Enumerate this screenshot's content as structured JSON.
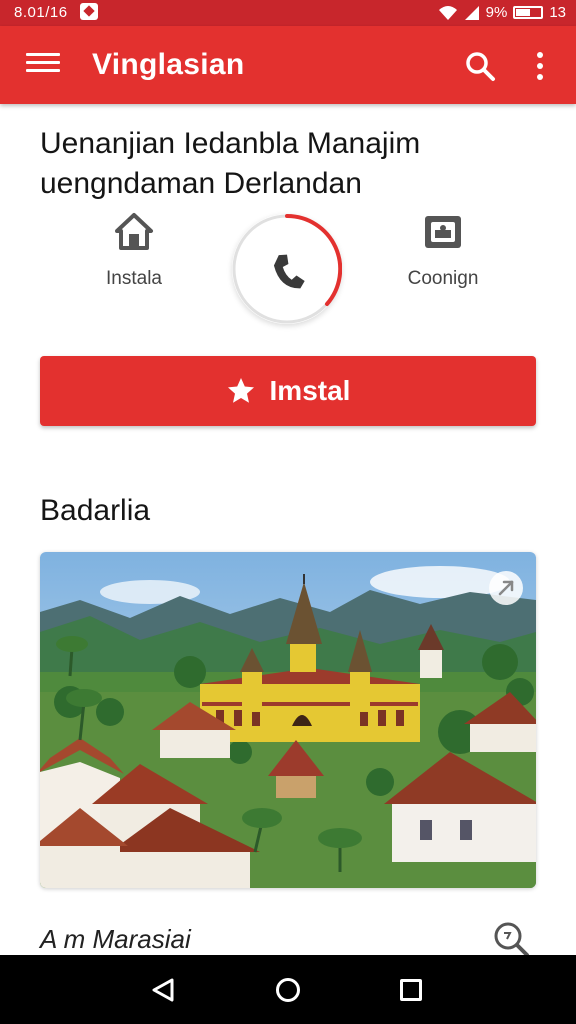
{
  "status_bar": {
    "time": "8.01/16",
    "battery": "9%",
    "extra": "13"
  },
  "app_bar": {
    "title": "Vinglasian"
  },
  "headline": {
    "line1": "Uenanjian Iedanbla Manajim",
    "line2": "uengndaman Derlandan"
  },
  "quick_actions": [
    {
      "label": "Instala",
      "icon": "home-icon"
    },
    {
      "label": "",
      "icon": "phone-icon"
    },
    {
      "label": "Coonign",
      "icon": "wallet-icon"
    }
  ],
  "primary_button": {
    "label": "Imstal",
    "icon": "star-icon"
  },
  "section": {
    "title": "Badarlia"
  },
  "photo": {
    "subject": "temple-village-landscape"
  },
  "subtitle": {
    "text": "A m Marasiai"
  },
  "colors": {
    "accent": "#e3312f",
    "status": "#c8262c",
    "text": "#151515"
  }
}
